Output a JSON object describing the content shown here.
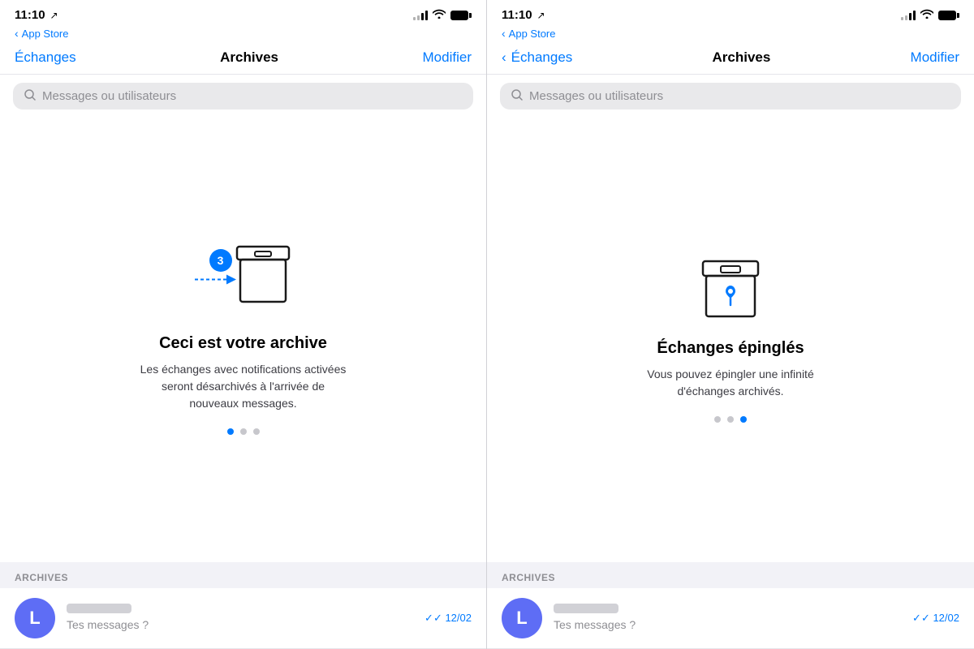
{
  "panel1": {
    "statusBar": {
      "time": "11:10",
      "arrow": "↗",
      "appStore": "App Store"
    },
    "nav": {
      "back": "Échanges",
      "title": "Archives",
      "action": "Modifier"
    },
    "search": {
      "placeholder": "Messages ou utilisateurs"
    },
    "carousel": {
      "title": "Ceci est votre archive",
      "description": "Les échanges avec notifications activées seront désarchivés à l'arrivée de nouveaux messages.",
      "badge": "3",
      "dots": [
        true,
        false,
        false
      ]
    },
    "sectionTitle": "ARCHIVES",
    "listItem": {
      "avatarLetter": "L",
      "preview": "Tes messages ?",
      "date": "12/02"
    }
  },
  "panel2": {
    "statusBar": {
      "time": "11:10",
      "arrow": "↗",
      "appStore": "App Store"
    },
    "nav": {
      "back": "Échanges",
      "title": "Archives",
      "action": "Modifier"
    },
    "search": {
      "placeholder": "Messages ou utilisateurs"
    },
    "carousel": {
      "title": "Échanges épinglés",
      "description": "Vous pouvez épingler une infinité d'échanges archivés.",
      "dots": [
        false,
        false,
        true
      ]
    },
    "sectionTitle": "ARCHIVES",
    "listItem": {
      "avatarLetter": "L",
      "preview": "Tes messages ?",
      "date": "12/02"
    }
  },
  "colors": {
    "blue": "#007AFF",
    "avatarBg": "#6e7ef5"
  }
}
